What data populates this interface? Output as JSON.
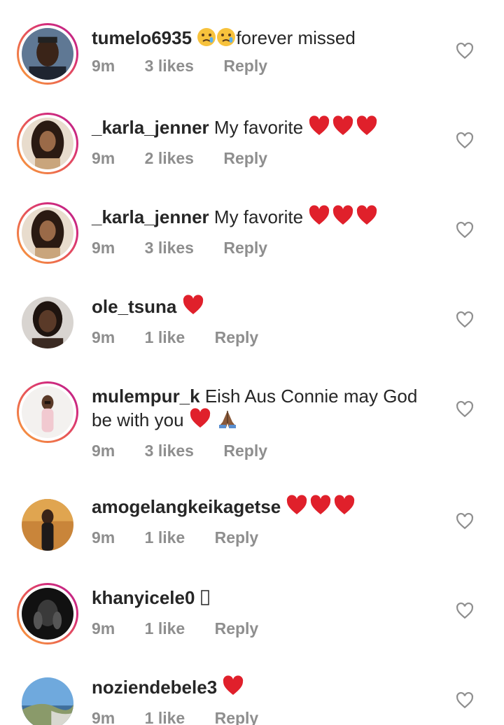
{
  "comments": [
    {
      "username": "tumelo6935",
      "text_after": "forever missed",
      "time": "9m",
      "likes": "3 likes",
      "reply": "Reply",
      "text_before_emojis": "",
      "emojis": [
        "crying-face",
        "crying-face"
      ]
    },
    {
      "username": "_karla_jenner",
      "text": "My favorite",
      "time": "9m",
      "likes": "2 likes",
      "reply": "Reply",
      "emojis": [
        "red-heart",
        "red-heart",
        "red-heart"
      ]
    },
    {
      "username": "_karla_jenner",
      "text": "My favorite",
      "time": "9m",
      "likes": "3 likes",
      "reply": "Reply",
      "emojis": [
        "red-heart",
        "red-heart",
        "red-heart"
      ]
    },
    {
      "username": "ole_tsuna",
      "text": "",
      "time": "9m",
      "likes": "1 like",
      "reply": "Reply",
      "emojis": [
        "red-heart"
      ]
    },
    {
      "username": "mulempur_k",
      "text": "Eish Aus Connie may God",
      "text_line2": "be with you",
      "time": "9m",
      "likes": "3 likes",
      "reply": "Reply",
      "emojis": [
        "red-heart",
        "folded-hands"
      ]
    },
    {
      "username": "amogelangkeikagetse",
      "text": "",
      "time": "9m",
      "likes": "1 like",
      "reply": "Reply",
      "emojis": [
        "red-heart",
        "red-heart",
        "red-heart"
      ]
    },
    {
      "username": "khanyicele0",
      "text": "",
      "time": "9m",
      "likes": "1 like",
      "reply": "Reply",
      "emojis": [
        "missing-glyph"
      ]
    },
    {
      "username": "noziendebele3",
      "text": "",
      "time": "9m",
      "likes": "1 like",
      "reply": "Reply",
      "emojis": [
        "red-heart"
      ]
    }
  ],
  "colors": {
    "text": "#262626",
    "meta": "#8e8e8e",
    "heart_emoji": "#e0202b",
    "story_ring_start": "#f9a43a",
    "story_ring_end": "#b61f8c"
  },
  "icons": {
    "like": "heart-outline-icon"
  }
}
